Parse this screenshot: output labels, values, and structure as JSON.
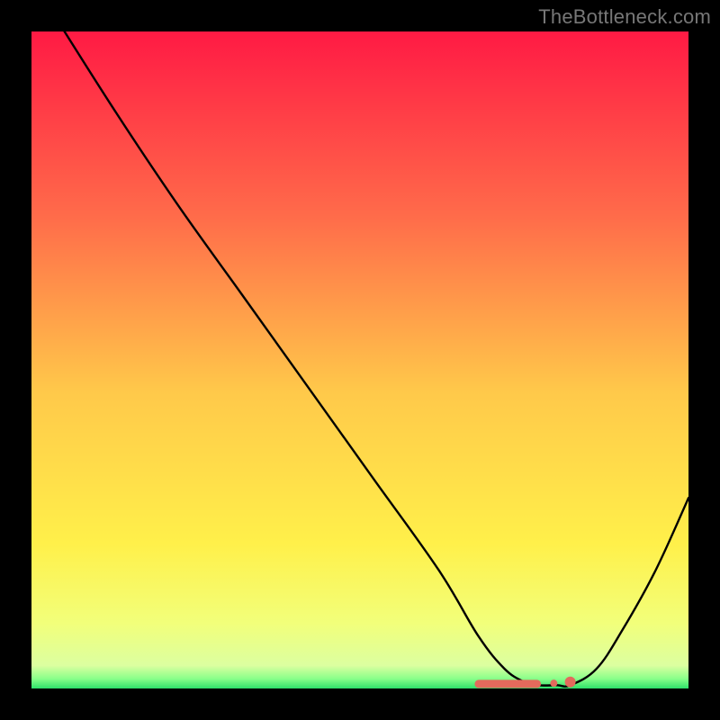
{
  "watermark": "TheBottleneck.com",
  "colors": {
    "bg": "#000000",
    "curve": "#000000",
    "marker": "#e36a5c",
    "gradient_top": "#ff1a44",
    "gradient_upper_mid": "#ff864a",
    "gradient_mid": "#ffd84a",
    "gradient_lower_mid": "#f6ff6a",
    "gradient_band": "#eaff8a",
    "gradient_bottom": "#2ee06a"
  },
  "chart_data": {
    "type": "line",
    "title": "",
    "xlabel": "",
    "ylabel": "",
    "ylim": [
      0,
      100
    ],
    "x": [
      0,
      12,
      22,
      32,
      42,
      52,
      62,
      68,
      72,
      75,
      77,
      80,
      82,
      86,
      90,
      95,
      100
    ],
    "values": [
      108,
      89,
      74,
      60,
      46,
      32,
      18,
      8,
      3,
      1,
      0.5,
      0.5,
      0.5,
      3,
      9,
      18,
      29
    ],
    "markers_x": [
      68,
      69,
      70,
      71,
      72,
      73,
      74,
      75,
      76,
      77,
      79.5,
      82
    ],
    "markers_y": [
      0.7,
      0.7,
      0.7,
      0.7,
      0.7,
      0.7,
      0.7,
      0.7,
      0.7,
      0.7,
      0.8,
      1.0
    ],
    "gradient_stops": [
      {
        "offset": 0.0,
        "color": "#ff1a44"
      },
      {
        "offset": 0.28,
        "color": "#ff6b4a"
      },
      {
        "offset": 0.55,
        "color": "#ffc94a"
      },
      {
        "offset": 0.78,
        "color": "#fff04a"
      },
      {
        "offset": 0.9,
        "color": "#f2ff7a"
      },
      {
        "offset": 0.965,
        "color": "#dcffa0"
      },
      {
        "offset": 0.985,
        "color": "#8aff8a"
      },
      {
        "offset": 1.0,
        "color": "#2ee06a"
      }
    ]
  }
}
